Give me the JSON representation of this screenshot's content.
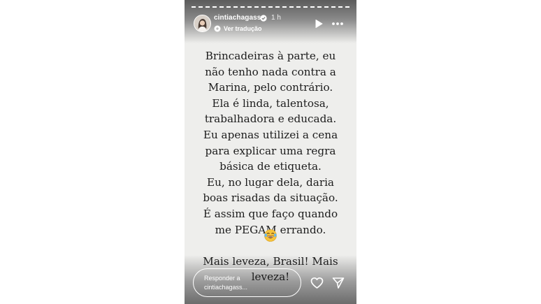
{
  "story": {
    "username": "cintiachagass",
    "time": "1 h",
    "translate_label": "Ver tradução",
    "lines": [
      "Brincadeiras à parte, eu",
      "não tenho nada contra a",
      "Marina, pelo contrário.",
      "Ela é linda, talentosa,",
      "trabalhadora e educada.",
      "Eu apenas utilizei a cena",
      "para explicar uma regra",
      "básica de etiqueta.",
      "Eu, no lugar dela, daria",
      "boas risadas da situação.",
      "É assim que faço quando",
      "me PEGAM errando."
    ],
    "closing_lines": [
      "Mais leveza, Brasil! Mais",
      "leveza!"
    ],
    "emoji": "laughing-tears-emoji"
  },
  "reply": {
    "placeholder_line1": "Responder a",
    "placeholder_line2": "cintiachagass..."
  },
  "icons": {
    "verified": "verified-badge-icon",
    "translate": "globe-icon",
    "play": "play-icon",
    "more": "more-options-icon",
    "like": "heart-icon",
    "send": "send-icon"
  },
  "colors": {
    "background": "#eeeeec",
    "text": "#1c1c1c",
    "overlay_text": "#ffffff"
  }
}
